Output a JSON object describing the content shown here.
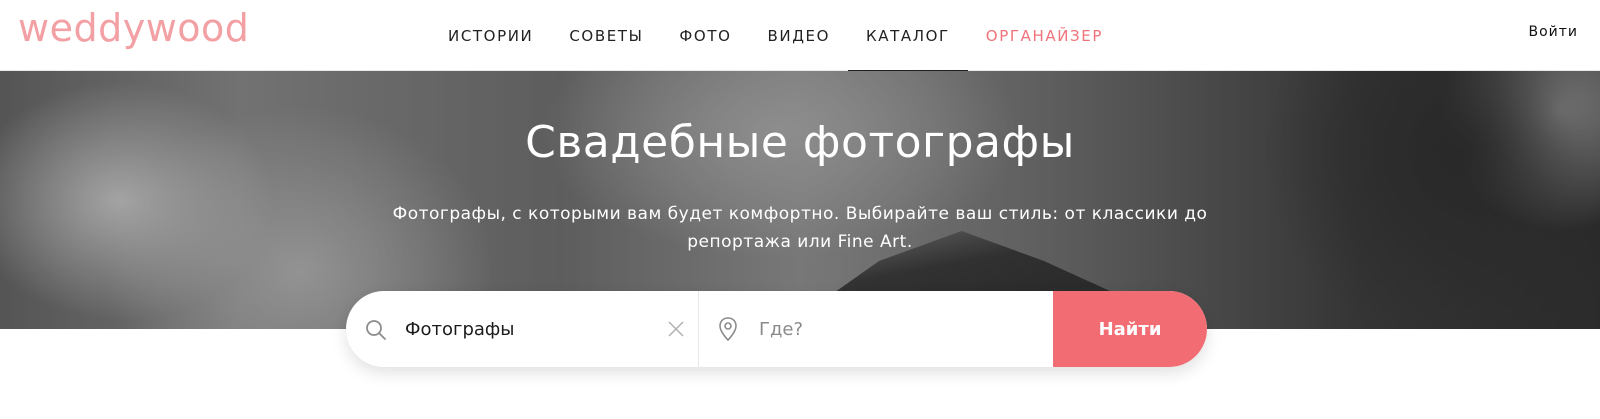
{
  "header": {
    "logo": "weddywood",
    "nav": [
      {
        "label": "ИСТОРИИ"
      },
      {
        "label": "СОВЕТЫ"
      },
      {
        "label": "ФОТО"
      },
      {
        "label": "ВИДЕО"
      },
      {
        "label": "КАТАЛОГ",
        "active": true
      },
      {
        "label": "ОРГАНАЙЗЕР",
        "accent": true
      }
    ],
    "login": "Войти"
  },
  "hero": {
    "title": "Свадебные фотографы",
    "subtitle": "Фотографы, с которыми вам будет комфортно. Выбирайте ваш стиль: от классики до репортажа или Fine Art."
  },
  "search": {
    "what_value": "Фотографы",
    "where_placeholder": "Где?",
    "button_label": "Найти",
    "icons": [
      "search-icon",
      "clear-icon",
      "location-pin-icon"
    ]
  },
  "colors": {
    "brand": "#f3a0a4",
    "accent": "#f0727a",
    "button": "#f26d73"
  }
}
